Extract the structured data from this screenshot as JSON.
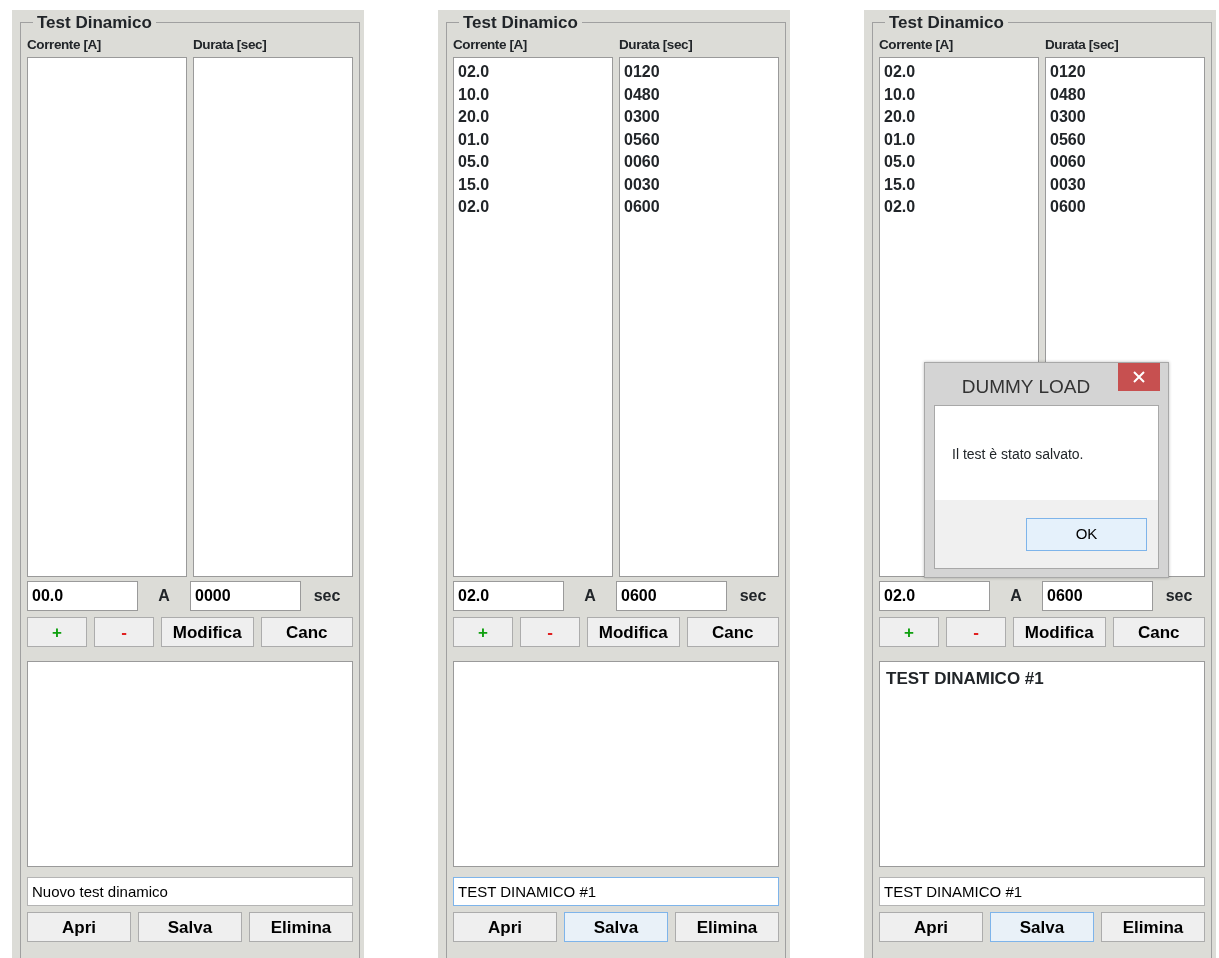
{
  "panels": [
    {
      "title": "Test Dinamico",
      "current_header": "Corrente [A]",
      "duration_header": "Durata [sec]",
      "current_value": "00.0",
      "current_unit": "A",
      "duration_value": "0000",
      "duration_unit": "sec",
      "edit_buttons": [
        {
          "label": "+",
          "kind": "add"
        },
        {
          "label": "-",
          "kind": "remove"
        },
        {
          "label": "Modifica",
          "kind": "plain"
        },
        {
          "label": "Canc",
          "kind": "plain"
        }
      ],
      "name_field": {
        "value": "Nuovo test dinamico",
        "focused": false
      },
      "file_buttons": [
        {
          "label": "Apri",
          "focused": false
        },
        {
          "label": "Salva",
          "focused": false
        },
        {
          "label": "Elimina",
          "focused": false
        }
      ]
    },
    {
      "title": "Test Dinamico",
      "current_header": "Corrente [A]",
      "duration_header": "Durata [sec]",
      "current_items": [
        "02.0",
        "10.0",
        "20.0",
        "01.0",
        "05.0",
        "15.0",
        "02.0"
      ],
      "duration_items": [
        "0120",
        "0480",
        "0300",
        "0560",
        "0060",
        "0030",
        "0600"
      ],
      "current_value": "02.0",
      "current_unit": "A",
      "duration_value": "0600",
      "duration_unit": "sec",
      "edit_buttons": [
        {
          "label": "+",
          "kind": "add"
        },
        {
          "label": "-",
          "kind": "remove"
        },
        {
          "label": "Modifica",
          "kind": "plain"
        },
        {
          "label": "Canc",
          "kind": "plain"
        }
      ],
      "name_field": {
        "value": "TEST DINAMICO #1",
        "focused": true
      },
      "file_buttons": [
        {
          "label": "Apri",
          "focused": false
        },
        {
          "label": "Salva",
          "focused": true
        },
        {
          "label": "Elimina",
          "focused": false
        }
      ]
    },
    {
      "title": "Test Dinamico",
      "current_header": "Corrente [A]",
      "duration_header": "Durata [sec]",
      "current_items": [
        "02.0",
        "10.0",
        "20.0",
        "01.0",
        "05.0",
        "15.0",
        "02.0"
      ],
      "duration_items": [
        "0120",
        "0480",
        "0300",
        "0560",
        "0060",
        "0030",
        "0600"
      ],
      "current_value": "02.0",
      "current_unit": "A",
      "duration_value": "0600",
      "duration_unit": "sec",
      "edit_buttons": [
        {
          "label": "+",
          "kind": "add"
        },
        {
          "label": "-",
          "kind": "remove"
        },
        {
          "label": "Modifica",
          "kind": "plain"
        },
        {
          "label": "Canc",
          "kind": "plain"
        }
      ],
      "tests": [
        "TEST DINAMICO #1"
      ],
      "name_field": {
        "value": "TEST DINAMICO #1",
        "focused": false
      },
      "file_buttons": [
        {
          "label": "Apri",
          "focused": false
        },
        {
          "label": "Salva",
          "focused": true
        },
        {
          "label": "Elimina",
          "focused": false
        }
      ],
      "dialog": {
        "title": "DUMMY LOAD",
        "message": "Il test è stato salvato.",
        "ok_label": "OK"
      }
    }
  ]
}
